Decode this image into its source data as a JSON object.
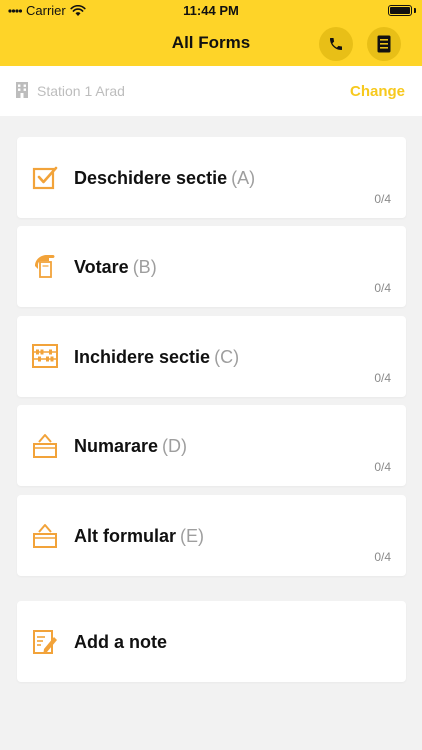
{
  "status_bar": {
    "carrier": "Carrier",
    "time": "11:44 PM"
  },
  "nav": {
    "title": "All Forms",
    "phone_icon": "phone-icon",
    "document_icon": "document-icon"
  },
  "station": {
    "name": "Station 1 Arad",
    "change_label": "Change"
  },
  "forms": [
    {
      "title": "Deschidere sectie",
      "code": "(A)",
      "progress": "0/4",
      "icon": "checkbox-icon"
    },
    {
      "title": "Votare",
      "code": "(B)",
      "progress": "0/4",
      "icon": "hand-ballot-icon"
    },
    {
      "title": "Inchidere sectie",
      "code": "(C)",
      "progress": "0/4",
      "icon": "abacus-icon"
    },
    {
      "title": "Numarare",
      "code": "(D)",
      "progress": "0/4",
      "icon": "ballot-box-icon"
    },
    {
      "title": "Alt formular",
      "code": "(E)",
      "progress": "0/4",
      "icon": "ballot-box-icon"
    }
  ],
  "note": {
    "label": "Add a note",
    "icon": "note-edit-icon"
  },
  "colors": {
    "accent": "#fed428",
    "accent_dark": "#e8bf17",
    "icon_orange": "#f2a33a",
    "change_text": "#f7c91e"
  }
}
